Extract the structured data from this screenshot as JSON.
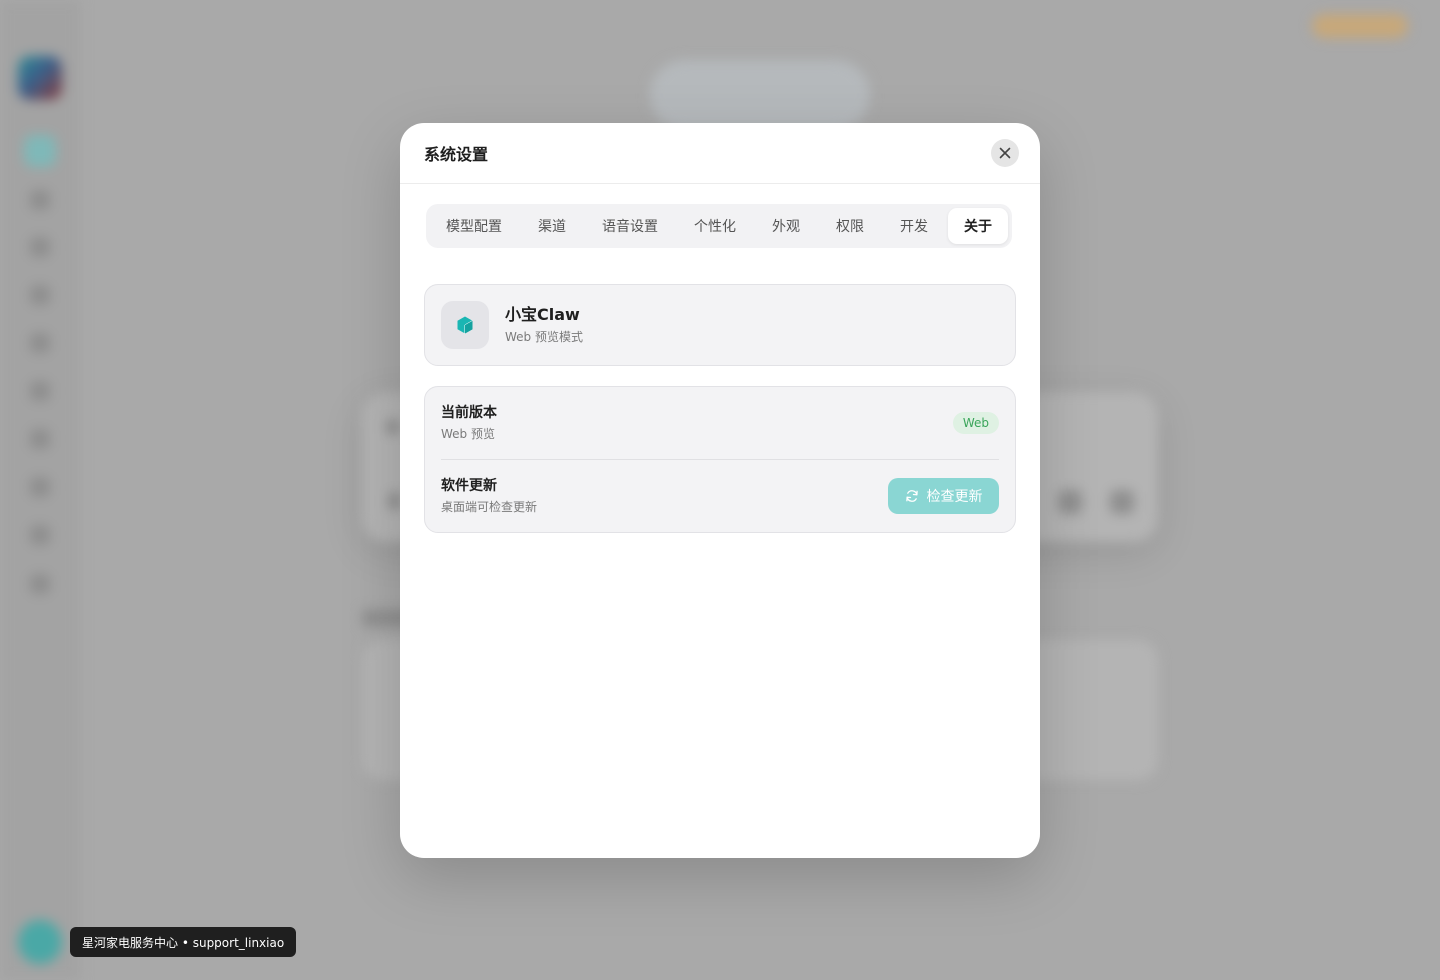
{
  "modal": {
    "title": "系统设置",
    "tabs": [
      {
        "label": "模型配置",
        "active": false
      },
      {
        "label": "渠道",
        "active": false
      },
      {
        "label": "语音设置",
        "active": false
      },
      {
        "label": "个性化",
        "active": false
      },
      {
        "label": "外观",
        "active": false
      },
      {
        "label": "权限",
        "active": false
      },
      {
        "label": "开发",
        "active": false
      },
      {
        "label": "关于",
        "active": true
      }
    ],
    "app_info": {
      "icon": "cube-icon",
      "name": "小宝Claw",
      "mode": "Web 预览模式"
    },
    "version_row": {
      "label": "当前版本",
      "value": "Web 预览",
      "badge": "Web"
    },
    "update_row": {
      "label": "软件更新",
      "description": "桌面端可检查更新",
      "button_label": "检查更新",
      "button_icon": "refresh-icon"
    }
  },
  "tooltip": {
    "text": "星河家电服务中心 • support_linxiao"
  },
  "colors": {
    "accent": "#1ab6b3",
    "button_disabled": "#8ad6d3",
    "badge_bg": "#dff1e3",
    "badge_text": "#3aa55a"
  }
}
